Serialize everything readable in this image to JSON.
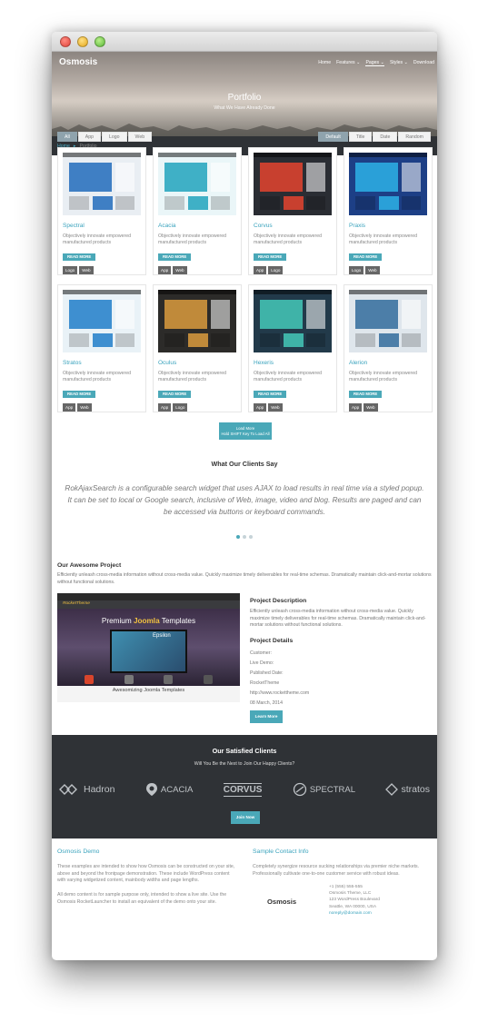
{
  "site": {
    "logo": "Osmosis",
    "nav": [
      "Home",
      "Features",
      "Pages",
      "Styles",
      "Download"
    ],
    "nav_chevrons": [
      "",
      "⌄",
      "⌄",
      "⌄",
      ""
    ],
    "hero_title": "Portfolio",
    "hero_subtitle": "What We Have Already Done"
  },
  "breadcrumb": {
    "home": "Home",
    "sep": "▸",
    "current": "Portfolio"
  },
  "filters": {
    "categories": [
      "All",
      "App",
      "Logo",
      "Web"
    ],
    "sort": [
      "Default",
      "Title",
      "Date",
      "Random"
    ]
  },
  "portfolio": [
    {
      "title": "Spectral",
      "desc": "Objectively innovate empowered manufactured products",
      "readmore": "READ MORE",
      "tags": [
        "Logo",
        "Web"
      ],
      "colors": [
        "#e9eef3",
        "#3f7fc4"
      ]
    },
    {
      "title": "Acacia",
      "desc": "Objectively innovate empowered manufactured products",
      "readmore": "READ MORE",
      "tags": [
        "App",
        "Web"
      ],
      "colors": [
        "#eaf6f8",
        "#3fb0c6"
      ]
    },
    {
      "title": "Corvus",
      "desc": "Objectively innovate empowered manufactured products",
      "readmore": "READ MORE",
      "tags": [
        "App",
        "Logo"
      ],
      "colors": [
        "#2a2d33",
        "#c8402f"
      ]
    },
    {
      "title": "Praxis",
      "desc": "Objectively innovate empowered manufactured products",
      "readmore": "READ MORE",
      "tags": [
        "Logo",
        "Web"
      ],
      "colors": [
        "#1d3f86",
        "#2aa0d8"
      ]
    },
    {
      "title": "Stratos",
      "desc": "Objectively innovate empowered manufactured products",
      "readmore": "READ MORE",
      "tags": [
        "App",
        "Web"
      ],
      "colors": [
        "#e9f2f7",
        "#3e8fd0"
      ]
    },
    {
      "title": "Oculus",
      "desc": "Objectively innovate empowered manufactured products",
      "readmore": "READ MORE",
      "tags": [
        "App",
        "Logo"
      ],
      "colors": [
        "#2c2b29",
        "#c08a3a"
      ]
    },
    {
      "title": "Hexeris",
      "desc": "Objectively innovate empowered manufactured products",
      "readmore": "READ MORE",
      "tags": [
        "App",
        "Web"
      ],
      "colors": [
        "#223a4a",
        "#3fb3a8"
      ]
    },
    {
      "title": "Alerion",
      "desc": "Objectively innovate empowered manufactured products",
      "readmore": "READ MORE",
      "tags": [
        "App",
        "Web"
      ],
      "colors": [
        "#dfe6ec",
        "#4c7ea8"
      ]
    }
  ],
  "load_more": {
    "label": "Load More",
    "hint": "Hold SHIFT Key To Load All"
  },
  "testimonial": {
    "title": "What Our Clients Say",
    "quote": "RokAjaxSearch is a configurable search widget that uses AJAX to load results in real time via a styled popup. It can be set to local or Google search, inclusive of Web, image, video and blog. Results are paged and can be accessed via buttons or keyboard commands."
  },
  "project": {
    "title": "Our Awesome Project",
    "intro": "Efficiently unleash cross-media information without cross-media value. Quickly maximize timely deliverables for real-time schemas. Dramatically maintain click-and-mortar solutions without functional solutions.",
    "image": {
      "logo": "RocketTheme",
      "headline_pre": "Premium ",
      "headline_brand": "Joomla",
      "headline_post": " Templates",
      "epsilon": "Epsilon",
      "footer": "Awesomizing Joomla Templates"
    },
    "desc_title": "Project Description",
    "desc": "Efficiently unleash cross-media information without cross-media value. Quickly maximize timely deliverables for real-time schemas. Dramatically maintain click-and-mortar solutions without functional solutions.",
    "details_title": "Project Details",
    "details": [
      "Customer:",
      "Live Demo:",
      "Published Date:",
      "RocketTheme",
      "http://www.rockettheme.com",
      "08 March, 2014"
    ],
    "learn_more": "Learn More"
  },
  "clients": {
    "title": "Our Satisfied Clients",
    "subtitle": "Will You Be the Next to Join Our Happy Clients?",
    "logos": [
      "Hadron",
      "ACACIA",
      "CORVUS",
      "SPECTRAL",
      "stratos"
    ],
    "join": "Join Now"
  },
  "footer": {
    "demo_title": "Osmosis Demo",
    "demo_p1": "These examples are intended to show how Osmosis can be constructed on your site, above and beyond the frontpage demonstration. These include WordPress content with varying widgetized content, mainbody widths and page lengths.",
    "demo_p2": "All demo content is for sample purpose only, intended to show a live site. Use the Osmosis RocketLauncher to install an equivalent of the demo onto your site.",
    "contact_title": "Sample Contact Info",
    "contact_p": "Completely synergize resource sucking relationships via premier niche markets. Professionally cultivate one-to-one customer service with robust ideas.",
    "logo": "Osmosis",
    "phone": "+1 (555) 555-555",
    "company": "Osmosis Theme, LLC",
    "street": "123 WordPress Boulevard",
    "city": "Seattle, WA 00000, USA",
    "email": "noreply@domain.com"
  }
}
